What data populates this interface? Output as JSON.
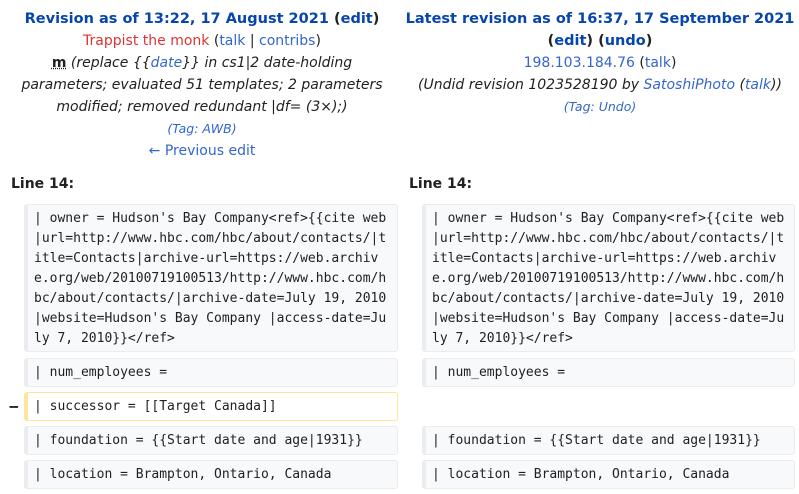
{
  "left": {
    "heading": "Revision as of 13:22, 17 August 2021",
    "edit": "edit",
    "user": "Trappist the monk",
    "talk": "talk",
    "contribs": "contribs",
    "minor": "m",
    "summary_pre": "(replace {{",
    "summary_link": "date",
    "summary_post": "}} in cs1|2 date-holding parameters; evaluated 51 templates; 2 parameters modified; removed redundant |df= (3×);)",
    "tag_label": "Tag:",
    "tag_value": "AWB",
    "prev": "← Previous edit",
    "line": "Line 14:"
  },
  "right": {
    "heading": "Latest revision as of 16:37, 17 September 2021",
    "edit": "edit",
    "undo": "undo",
    "user": "198.103.184.76",
    "talk": "talk",
    "undid_pre": "(Undid revision 1023528190 by",
    "undid_user": "SatoshiPhoto",
    "undid_talk": "talk",
    "tag_label": "Tag:",
    "tag_value": "Undo",
    "line": "Line 14:"
  },
  "diff": {
    "owner": "| owner = Hudson's Bay Company<ref>{{cite web|url=http://www.hbc.com/hbc/about/contacts/|title=Contacts|archive-url=https://web.archive.org/web/20100719100513/http://www.hbc.com/hbc/about/contacts/|archive-date=July 19, 2010|website=Hudson's Bay Company |access-date=July 7, 2010}}</ref>",
    "num_employees": "| num_employees = ",
    "successor": "| successor = [[Target Canada]]",
    "foundation": "| foundation = {{Start date and age|1931}}",
    "location": "| location = Brampton, Ontario, Canada",
    "removed_marker": "−"
  }
}
